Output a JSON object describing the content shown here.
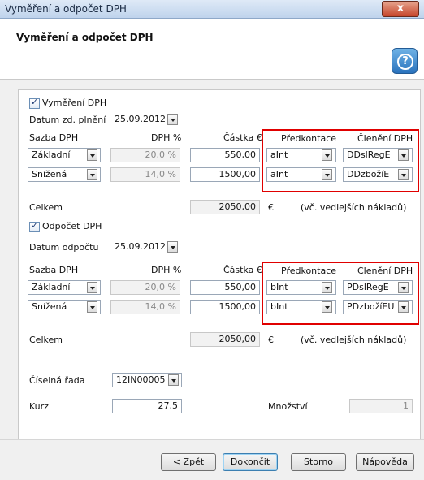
{
  "window": {
    "title": "Vyměření a odpočet DPH",
    "close_glyph": "x"
  },
  "header": {
    "title": "Vyměření a odpočet DPH",
    "help_icon": "help-circle-icon"
  },
  "vymereni": {
    "checkbox_label": "Vyměření DPH",
    "date_label": "Datum zd. plnění",
    "date_value": "25.09.2012",
    "col_sazba": "Sazba DPH",
    "col_dph": "DPH %",
    "col_castka": "Částka €",
    "col_predkontace": "Předkontace",
    "col_cleneni": "Členění DPH",
    "rows": [
      {
        "sazba": "Základní",
        "dph": "20,0 %",
        "castka": "550,00",
        "predkontace": "aInt",
        "cleneni": "DDslRegE"
      },
      {
        "sazba": "Snížená",
        "dph": "14,0 %",
        "castka": "1500,00",
        "predkontace": "aInt",
        "cleneni": "DDzbožíE"
      }
    ],
    "total_label": "Celkem",
    "total_value": "2050,00",
    "currency": "€",
    "note": "(vč. vedlejších nákladů)"
  },
  "odpocet": {
    "checkbox_label": "Odpočet DPH",
    "date_label": "Datum odpočtu",
    "date_value": "25.09.2012",
    "col_sazba": "Sazba DPH",
    "col_dph": "DPH %",
    "col_castka": "Částka €",
    "col_predkontace": "Předkontace",
    "col_cleneni": "Členění DPH",
    "rows": [
      {
        "sazba": "Základní",
        "dph": "20,0 %",
        "castka": "550,00",
        "predkontace": "bInt",
        "cleneni": "PDslRegE"
      },
      {
        "sazba": "Snížená",
        "dph": "14,0 %",
        "castka": "1500,00",
        "predkontace": "bInt",
        "cleneni": "PDzbožíEU"
      }
    ],
    "total_label": "Celkem",
    "total_value": "2050,00",
    "currency": "€",
    "note": "(vč. vedlejších nákladů)"
  },
  "cislena_rada": {
    "label": "Číselná řada",
    "value": "12IN00005"
  },
  "kurz": {
    "label": "Kurz",
    "value": "27,5"
  },
  "mnozstvi": {
    "label": "Množství",
    "value": "1"
  },
  "buttons": {
    "back": "< Zpět",
    "finish": "Dokončit",
    "cancel": "Storno",
    "help": "Nápověda"
  },
  "colors": {
    "highlight": "#e00000",
    "accent": "#2a73bd"
  }
}
